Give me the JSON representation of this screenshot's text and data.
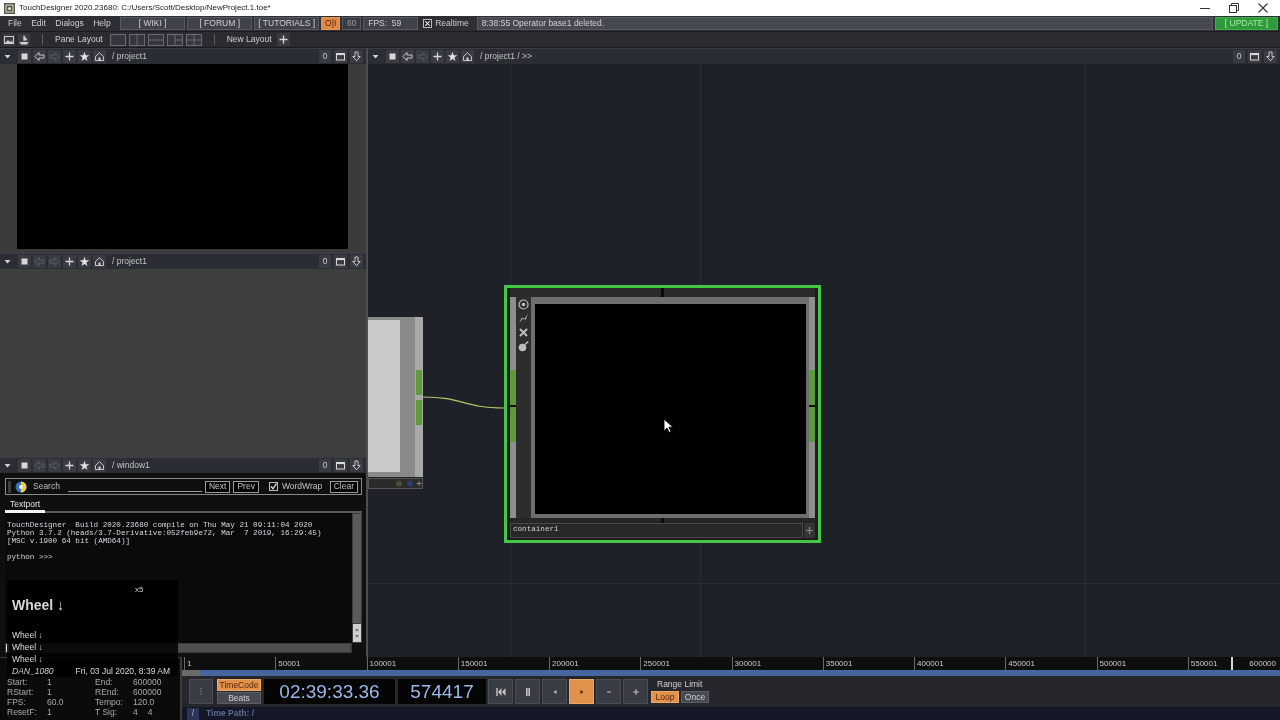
{
  "window": {
    "title": "TouchDesigner 2020.23680: C:/Users/Scott/Desktop/NewProject.1.toe*"
  },
  "menu_bar": {
    "menus": [
      "File",
      "Edit",
      "Dialogs",
      "Help"
    ],
    "links": [
      "[ WIKI ]",
      "[ FORUM ]",
      "[ TUTORIALS ]"
    ],
    "perform_button": {
      "label": "O|I",
      "on": true
    },
    "fps_limit": {
      "label": "60",
      "disabled": true
    },
    "fps_readout": "FPS:  59",
    "realtime": {
      "label": "Realtime",
      "checked": true
    },
    "status_message": "8:38:55 Operator base1 deleted.",
    "update_button": "[ UPDATE ]"
  },
  "layout_bar": {
    "pane_layout_label": "Pane Layout",
    "new_layout_label": "New Layout"
  },
  "panes": [
    {
      "kind": "viewer",
      "path": "/ project1",
      "back_enabled": true,
      "forward_enabled": false,
      "count": "0"
    },
    {
      "kind": "empty",
      "path": "/ project1",
      "back_enabled": false,
      "forward_enabled": false,
      "count": "0"
    },
    {
      "kind": "textport",
      "path": "/ window1",
      "back_enabled": false,
      "forward_enabled": false,
      "count": "0"
    }
  ],
  "textport": {
    "search_label": "Search",
    "buttons": [
      "Next",
      "Prev"
    ],
    "word_wrap": {
      "label": "WordWrap",
      "checked": true
    },
    "clear_button": "Clear",
    "tabs": [
      {
        "label": "Textport",
        "selected": true
      }
    ],
    "output": [
      "TouchDesigner  Build 2020.23680 compile on Thu May 21 09:11:04 2020",
      "Python 3.7.2 (heads/3.7-Derivative:052feb9e72, Mar  7 2019, 16:29:45)",
      "[MSC v.1900 64 bit (AMD64)]"
    ],
    "prompt": "python >>>"
  },
  "network": {
    "path": "/ project1 / >>",
    "back_enabled": true,
    "forward_enabled": false,
    "count": "0",
    "nodes": [
      {
        "kind": "partial",
        "selected": false
      },
      {
        "kind": "container",
        "name": "container1",
        "selected": true
      }
    ]
  },
  "key_overlay": {
    "repeat": "x5",
    "current": "Wheel ↓",
    "history": [
      "Wheel ↓",
      "Wheel ↓",
      "Wheel ↓"
    ],
    "user": "DAN_1080",
    "date": "Fri, 03 Jul 2020, 8:39 AM"
  },
  "timeline": {
    "info": [
      {
        "label": "Start:",
        "values": [
          "1"
        ]
      },
      {
        "label": "End:",
        "values": [
          "600000"
        ]
      },
      {
        "label": "RStart:",
        "values": [
          "1"
        ]
      },
      {
        "label": "REnd:",
        "values": [
          "600000"
        ]
      },
      {
        "label": "FPS:",
        "values": [
          "60.0"
        ]
      },
      {
        "label": "Tempo:",
        "values": [
          "120.0"
        ]
      },
      {
        "label": "ResetF:",
        "values": [
          "1"
        ]
      },
      {
        "label": "T Sig:",
        "values": [
          "4",
          "4"
        ]
      }
    ],
    "ruler": {
      "labels": [
        "1",
        "50001",
        "100001",
        "150001",
        "200001",
        "250001",
        "300001",
        "350001",
        "400001",
        "450001",
        "500001",
        "550001"
      ],
      "end_label": "600000",
      "playhead": {
        "level": 0.957
      }
    },
    "time_modes": [
      {
        "label": "TimeCode",
        "selected": true
      },
      {
        "label": "Beats",
        "selected": false
      }
    ],
    "timecode": "02:39:33.36",
    "frame": "574417",
    "transport": [
      {
        "kind": "rewind",
        "selected": false
      },
      {
        "kind": "pause",
        "selected": false
      },
      {
        "kind": "reverse",
        "selected": false
      },
      {
        "kind": "play",
        "selected": true
      },
      {
        "kind": "step_back",
        "selected": false
      },
      {
        "kind": "step_forward",
        "selected": false
      }
    ],
    "range_limit": {
      "label": "Range Limit",
      "options": [
        {
          "label": "Loop",
          "selected": true
        },
        {
          "label": "Once",
          "selected": false
        }
      ]
    },
    "time_path": {
      "button": "/",
      "label": "Time Path: /"
    }
  }
}
